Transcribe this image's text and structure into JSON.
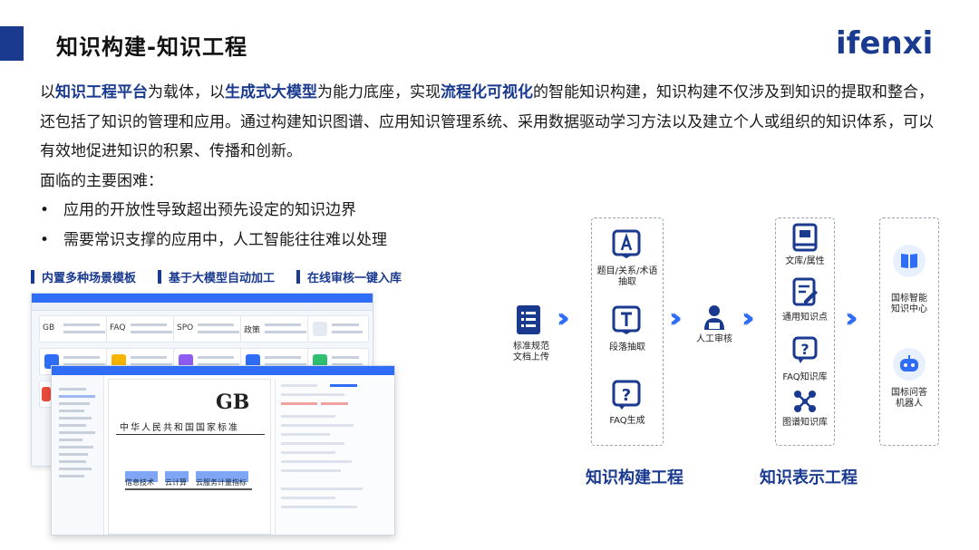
{
  "header": {
    "title": "知识构建-知识工程",
    "logo_text": "ifenxi"
  },
  "intro": {
    "p1_a": "以",
    "p1_em1": "知识工程平台",
    "p1_b": "为载体，以",
    "p1_em2": "生成式大模型",
    "p1_c": "为能力底座，实现",
    "p1_em3": "流程化可视化",
    "p1_d": "的智能知识构建，知识构建不仅涉及到知识的提取和整合，还包括了知识的管理和应用。通过构建知识图谱、应用知识管理系统、采用数据驱动学习方法以及建立个人或组织的知识体系，可以有效地促进知识的积累、传播和创新。",
    "challenges_heading": "面临的主要困难："
  },
  "bullets": [
    "应用的开放性导致超出预先设定的知识边界",
    "需要常识支撑的应用中，人工智能往往难以处理"
  ],
  "feature_tags": [
    "内置多种场景模板",
    "基于大模型自动加工",
    "在线审核一键入库"
  ],
  "mockup": {
    "card_gb": "GB",
    "card_faq": "FAQ",
    "card_spo": "SPO",
    "card_policy": "政策",
    "doc_logo": "GB",
    "doc_title": "中华人民共和国国家标准",
    "doc_highlight1": "信息技术",
    "doc_highlight2": "云计算",
    "doc_highlight3": "云服务计量指标"
  },
  "flow": {
    "upload": "标准规范\n文档上传",
    "extract_terms": "题目/关系/术语\n抽取",
    "extract_para": "段落抽取",
    "faq_gen": "FAQ生成",
    "review": "人工审核",
    "library_attr": "文库/属性",
    "general_kp": "通用知识点",
    "faq_lib": "FAQ知识库",
    "graph_lib": "图谱知识库",
    "intl_center": "国标智能\n知识中心",
    "intl_bot": "国标问答\n机器人",
    "section_build": "知识构建工程",
    "section_repr": "知识表示工程"
  },
  "colors": {
    "primary": "#1a3a8f",
    "accent": "#2f6df6"
  }
}
